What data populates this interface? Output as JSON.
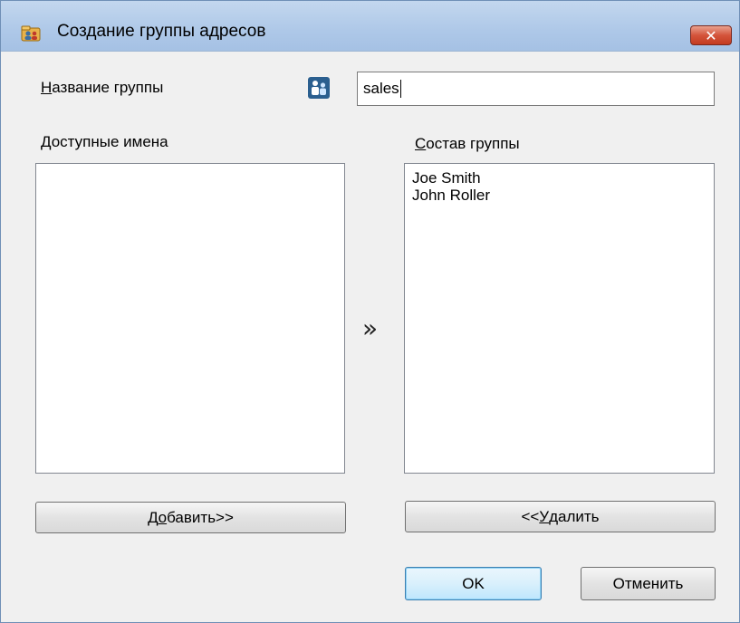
{
  "window": {
    "title": "Создание группы адресов",
    "close_symbol": "✕",
    "icon": "address-book-icon",
    "close_color": "#c9462b"
  },
  "form": {
    "group_name_label_hotkey": "Н",
    "group_name_label_rest": "азвание группы",
    "group_icon": "group-people-icon",
    "group_name_value": "sales"
  },
  "available": {
    "label_hotkey": "Д",
    "label_rest": "оступные имена",
    "items": []
  },
  "members": {
    "label_hotkey": "С",
    "label_rest": "остав группы",
    "items": [
      "Joe Smith",
      "John Roller"
    ]
  },
  "transfer_arrows": "»",
  "buttons": {
    "add_pre": "Д",
    "add_hotkey": "о",
    "add_post": "бавить>>",
    "remove_pre": "<<",
    "remove_hotkey": "У",
    "remove_post": "далить",
    "ok": "OK",
    "cancel": "Отменить"
  }
}
